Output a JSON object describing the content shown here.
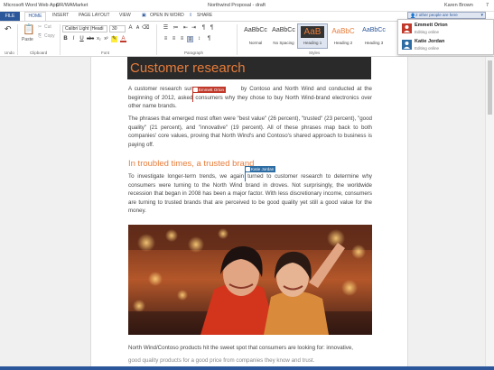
{
  "titlebar": {
    "app_name": "Microsoft Word Web App",
    "breadcrumb": "OR/WAMarket",
    "document_title": "Northwind Proposal - draft",
    "user_name": "Karen Brown",
    "page_indicator": "7"
  },
  "tabs": {
    "file": "FILE",
    "home": "HOME",
    "insert": "INSERT",
    "page_layout": "PAGE LAYOUT",
    "view": "VIEW",
    "open_in_word": "OPEN IN WORD",
    "share": "SHARE"
  },
  "ribbon": {
    "undo_label": "Undo",
    "paste_label": "Paste",
    "cut_label": "Cut",
    "copy_label": "Copy",
    "clipboard_group": "Clipboard",
    "font_name": "Calibri Light (Headi",
    "font_size": "30",
    "font_group": "Font",
    "paragraph_group": "Paragraph",
    "styles_group": "Styles",
    "bold": "B",
    "italic": "I",
    "underline": "U",
    "styles": [
      {
        "sample": "AaBbCc",
        "name": "Normal"
      },
      {
        "sample": "AaBbCc",
        "name": "No Spacing"
      },
      {
        "sample": "AaB",
        "name": "Heading 1"
      },
      {
        "sample": "AaBbC",
        "name": "Heading 2"
      },
      {
        "sample": "AaBbCc",
        "name": "Heading 3"
      }
    ]
  },
  "coauthoring": {
    "button_label": "2 other people are here",
    "people": [
      {
        "name": "Emmett Orton",
        "status": "Editing online",
        "color": "#c0392b"
      },
      {
        "name": "Katie Jordan",
        "status": "Editing online",
        "color": "#2e6da4"
      }
    ]
  },
  "document": {
    "title": "Customer research",
    "para1_a": "A customer research sur",
    "para1_b": "by Contoso and North Wind and conducted at the beginning of 2012, asked",
    "para1_c": "consumers why they chose to buy North Wind-brand electronics over other name brands.",
    "para2": "The phrases that emerged most often were \"best value\" (26 percent), \"trusted\" (23 percent), \"good quality\" (21 percent), and \"innovative\" (19 percent). All of these phrases map back to both companies' core values, proving that North Wind's and Contoso's shared approach to business is paying off.",
    "heading2": "In troubled times, a trusted brand",
    "para3_a": "To investigate longer-term trends, we again",
    "para3_b": "turned to customer research to determine why consumers were turning to the North Wind brand in droves. Not surprisingly, the worldwide recession that began in 2008 has been a major factor. With less discretionary income, consumers are turning to trusted brands that are perceived to be good quality yet still a good value for the money.",
    "para4": "North Wind/Contoso products hit the sweet spot that consumers are looking for: innovative,",
    "para5": "good quality products for a good price from companies they know and trust.",
    "cursor_tags": [
      {
        "name": "Emmett Orton",
        "color": "#c0392b"
      },
      {
        "name": "Katie Jordan",
        "color": "#2e6da4"
      }
    ]
  }
}
